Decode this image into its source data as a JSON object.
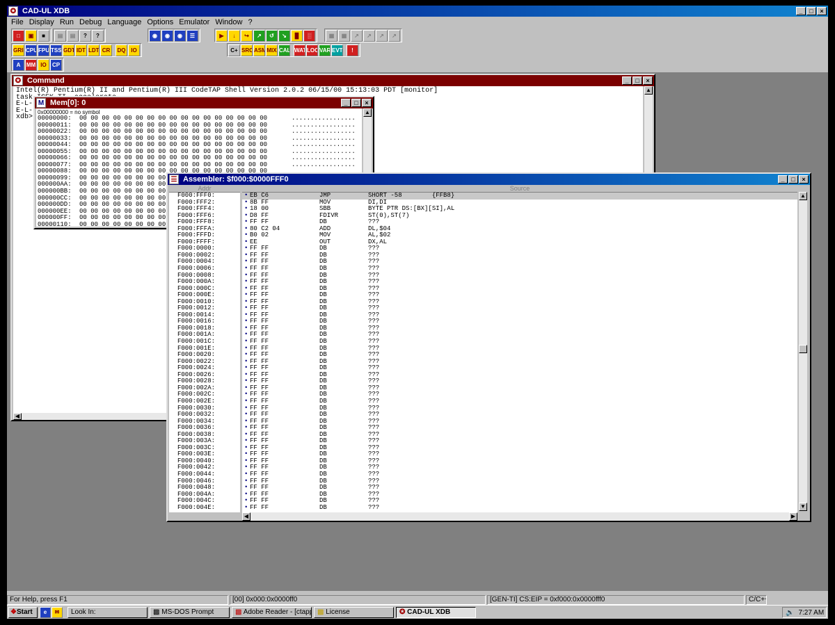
{
  "app": {
    "title": "CAD-UL XDB",
    "window_controls": [
      "_",
      "□",
      "×"
    ]
  },
  "menu": [
    "File",
    "Display",
    "Run",
    "Debug",
    "Language",
    "Options",
    "Emulator",
    "Window",
    "?"
  ],
  "toolbar": {
    "row1": [
      [
        "new-icon",
        "open-icon",
        "save-icon"
      ],
      [
        "copy-icon",
        "print-icon",
        "help-icon",
        "context-help-icon"
      ],
      [
        "search-icon",
        "search-next-icon",
        "search-prev-icon",
        "list-icon"
      ],
      [
        "go-icon",
        "step-icon",
        "stepover-icon",
        "break-icon",
        "reset-icon",
        "watch-icon",
        "stack-icon",
        "trace-icon",
        "regs-icon"
      ],
      [
        "disabled-a-icon",
        "disabled-b-icon",
        "disabled-c-icon",
        "disabled-d-icon",
        "disabled-e-icon",
        "disabled-f-icon"
      ]
    ],
    "row1_labels": [
      [
        "",
        "",
        ""
      ],
      [
        "",
        "",
        "?",
        "?"
      ],
      [
        "",
        "",
        "",
        ""
      ],
      [
        "",
        "",
        "",
        "",
        "",
        "",
        "",
        "",
        ""
      ],
      [
        "",
        "",
        "",
        "",
        "",
        ""
      ]
    ],
    "row2_left": [
      "GRID",
      "CPU",
      "FPU",
      "TSS",
      "GDT",
      "IDT",
      "LDT",
      "CR",
      "DQ",
      "IO"
    ],
    "row2_right": [
      "C+",
      "SRC",
      "ASM",
      "MIX",
      "CALL",
      "WAT",
      "LOC",
      "VAR",
      "EVT",
      "!"
    ],
    "row3": [
      "A",
      "MM",
      "IO",
      "CP"
    ]
  },
  "command_window": {
    "title": "Command",
    "lines": [
      "Intel(R) Pentium(R) II and Pentium(R) III CodeTAP Shell Version 2.0.2 06/15/00 15:13:03 PDT [monitor]",
      "task ICEK_TI, accelerate",
      "E-L-",
      "E-L-",
      "xdb>"
    ]
  },
  "mem_window": {
    "title": "Mem[0]: 0",
    "header": "0x00000000 = no symbol",
    "rows": [
      {
        "addr": "00000000:",
        "bytes": "00 00 00 00 00 00 00 00 00 00 00 00 00 00 00 00 00",
        "ascii": "................."
      },
      {
        "addr": "00000011:",
        "bytes": "00 00 00 00 00 00 00 00 00 00 00 00 00 00 00 00 00",
        "ascii": "................."
      },
      {
        "addr": "00000022:",
        "bytes": "00 00 00 00 00 00 00 00 00 00 00 00 00 00 00 00 00",
        "ascii": "................."
      },
      {
        "addr": "00000033:",
        "bytes": "00 00 00 00 00 00 00 00 00 00 00 00 00 00 00 00 00",
        "ascii": "................."
      },
      {
        "addr": "00000044:",
        "bytes": "00 00 00 00 00 00 00 00 00 00 00 00 00 00 00 00 00",
        "ascii": "................."
      },
      {
        "addr": "00000055:",
        "bytes": "00 00 00 00 00 00 00 00 00 00 00 00 00 00 00 00 00",
        "ascii": "................."
      },
      {
        "addr": "00000066:",
        "bytes": "00 00 00 00 00 00 00 00 00 00 00 00 00 00 00 00 00",
        "ascii": "................."
      },
      {
        "addr": "00000077:",
        "bytes": "00 00 00 00 00 00 00 00 00 00 00 00 00 00 00 00 00",
        "ascii": "................."
      },
      {
        "addr": "00000088:",
        "bytes": "00 00 00 00 00 00 00 00 00 00 00 00 00 00 00 00 00",
        "ascii": ""
      },
      {
        "addr": "00000099:",
        "bytes": "00 00 00 00 00 00 00 00 00 00 00 00",
        "ascii": ""
      },
      {
        "addr": "000000AA:",
        "bytes": "00 00 00 00 00 00 00 00 00 00 00 00",
        "ascii": ""
      },
      {
        "addr": "000000BB:",
        "bytes": "00 00 00 00 00 00 00 00 00 00 00 00",
        "ascii": ""
      },
      {
        "addr": "000000CC:",
        "bytes": "00 00 00 00 00 00 00 00 00 00 00 00",
        "ascii": ""
      },
      {
        "addr": "000000DD:",
        "bytes": "00 00 00 00 00 00 00 00 00 00 00 00",
        "ascii": ""
      },
      {
        "addr": "000000EE:",
        "bytes": "00 00 00 00 00 00 00 00 00 00 00 00",
        "ascii": ""
      },
      {
        "addr": "000000FF:",
        "bytes": "00 00 00 00 00 00 00 00 00 00 00 00",
        "ascii": ""
      },
      {
        "addr": "00000110:",
        "bytes": "00 00 00 00 00 00 00 00 00 00 00 00",
        "ascii": ""
      }
    ]
  },
  "asm_window": {
    "title": "Assembler:  $f000:$0000FFF0",
    "col_addr": "Addr",
    "col_source": "Source",
    "rows": [
      {
        "addr": "F000:FFF0:",
        "bytes": "EB C6",
        "mn": "JMP",
        "op": "SHORT -58        {FFB8}"
      },
      {
        "addr": "F000:FFF2:",
        "bytes": "8B FF",
        "mn": "MOV",
        "op": "DI,DI"
      },
      {
        "addr": "F000:FFF4:",
        "bytes": "18 00",
        "mn": "SBB",
        "op": "BYTE PTR DS:[BX][SI],AL"
      },
      {
        "addr": "F000:FFF6:",
        "bytes": "D8 FF",
        "mn": "FDIVR",
        "op": "ST(0),ST(7)"
      },
      {
        "addr": "F000:FFF8:",
        "bytes": "FF FF",
        "mn": "DB",
        "op": "???"
      },
      {
        "addr": "F000:FFFA:",
        "bytes": "80 C2 04",
        "mn": "ADD",
        "op": "DL,$04"
      },
      {
        "addr": "F000:FFFD:",
        "bytes": "B0 02",
        "mn": "MOV",
        "op": "AL,$02"
      },
      {
        "addr": "F000:FFFF:",
        "bytes": "EE",
        "mn": "OUT",
        "op": "DX,AL"
      },
      {
        "addr": "F000:0000:",
        "bytes": "FF FF",
        "mn": "DB",
        "op": "???"
      },
      {
        "addr": "F000:0002:",
        "bytes": "FF FF",
        "mn": "DB",
        "op": "???"
      },
      {
        "addr": "F000:0004:",
        "bytes": "FF FF",
        "mn": "DB",
        "op": "???"
      },
      {
        "addr": "F000:0006:",
        "bytes": "FF FF",
        "mn": "DB",
        "op": "???"
      },
      {
        "addr": "F000:0008:",
        "bytes": "FF FF",
        "mn": "DB",
        "op": "???"
      },
      {
        "addr": "F000:000A:",
        "bytes": "FF FF",
        "mn": "DB",
        "op": "???"
      },
      {
        "addr": "F000:000C:",
        "bytes": "FF FF",
        "mn": "DB",
        "op": "???"
      },
      {
        "addr": "F000:000E:",
        "bytes": "FF FF",
        "mn": "DB",
        "op": "???"
      },
      {
        "addr": "F000:0010:",
        "bytes": "FF FF",
        "mn": "DB",
        "op": "???"
      },
      {
        "addr": "F000:0012:",
        "bytes": "FF FF",
        "mn": "DB",
        "op": "???"
      },
      {
        "addr": "F000:0014:",
        "bytes": "FF FF",
        "mn": "DB",
        "op": "???"
      },
      {
        "addr": "F000:0016:",
        "bytes": "FF FF",
        "mn": "DB",
        "op": "???"
      },
      {
        "addr": "F000:0018:",
        "bytes": "FF FF",
        "mn": "DB",
        "op": "???"
      },
      {
        "addr": "F000:001A:",
        "bytes": "FF FF",
        "mn": "DB",
        "op": "???"
      },
      {
        "addr": "F000:001C:",
        "bytes": "FF FF",
        "mn": "DB",
        "op": "???"
      },
      {
        "addr": "F000:001E:",
        "bytes": "FF FF",
        "mn": "DB",
        "op": "???"
      },
      {
        "addr": "F000:0020:",
        "bytes": "FF FF",
        "mn": "DB",
        "op": "???"
      },
      {
        "addr": "F000:0022:",
        "bytes": "FF FF",
        "mn": "DB",
        "op": "???"
      },
      {
        "addr": "F000:0024:",
        "bytes": "FF FF",
        "mn": "DB",
        "op": "???"
      },
      {
        "addr": "F000:0026:",
        "bytes": "FF FF",
        "mn": "DB",
        "op": "???"
      },
      {
        "addr": "F000:0028:",
        "bytes": "FF FF",
        "mn": "DB",
        "op": "???"
      },
      {
        "addr": "F000:002A:",
        "bytes": "FF FF",
        "mn": "DB",
        "op": "???"
      },
      {
        "addr": "F000:002C:",
        "bytes": "FF FF",
        "mn": "DB",
        "op": "???"
      },
      {
        "addr": "F000:002E:",
        "bytes": "FF FF",
        "mn": "DB",
        "op": "???"
      },
      {
        "addr": "F000:0030:",
        "bytes": "FF FF",
        "mn": "DB",
        "op": "???"
      },
      {
        "addr": "F000:0032:",
        "bytes": "FF FF",
        "mn": "DB",
        "op": "???"
      },
      {
        "addr": "F000:0034:",
        "bytes": "FF FF",
        "mn": "DB",
        "op": "???"
      },
      {
        "addr": "F000:0036:",
        "bytes": "FF FF",
        "mn": "DB",
        "op": "???"
      },
      {
        "addr": "F000:0038:",
        "bytes": "FF FF",
        "mn": "DB",
        "op": "???"
      },
      {
        "addr": "F000:003A:",
        "bytes": "FF FF",
        "mn": "DB",
        "op": "???"
      },
      {
        "addr": "F000:003C:",
        "bytes": "FF FF",
        "mn": "DB",
        "op": "???"
      },
      {
        "addr": "F000:003E:",
        "bytes": "FF FF",
        "mn": "DB",
        "op": "???"
      },
      {
        "addr": "F000:0040:",
        "bytes": "FF FF",
        "mn": "DB",
        "op": "???"
      },
      {
        "addr": "F000:0042:",
        "bytes": "FF FF",
        "mn": "DB",
        "op": "???"
      },
      {
        "addr": "F000:0044:",
        "bytes": "FF FF",
        "mn": "DB",
        "op": "???"
      },
      {
        "addr": "F000:0046:",
        "bytes": "FF FF",
        "mn": "DB",
        "op": "???"
      },
      {
        "addr": "F000:0048:",
        "bytes": "FF FF",
        "mn": "DB",
        "op": "???"
      },
      {
        "addr": "F000:004A:",
        "bytes": "FF FF",
        "mn": "DB",
        "op": "???"
      },
      {
        "addr": "F000:004C:",
        "bytes": "FF FF",
        "mn": "DB",
        "op": "???"
      },
      {
        "addr": "F000:004E:",
        "bytes": "FF FF",
        "mn": "DB",
        "op": "???"
      }
    ]
  },
  "status": {
    "help": "For Help, press F1",
    "mem_addr": "[00] 0x000:0x0000ff0",
    "target": "[GEN-TI] CS:EIP = 0xf000:0x0000fff0",
    "lang": "C/C++"
  },
  "taskbar": {
    "start": "Start",
    "tasks": [
      {
        "label": "Look In:",
        "active": false
      },
      {
        "label": "MS-DOS Prompt",
        "active": false
      },
      {
        "label": "Adobe Reader - [ctapp.pdf]",
        "active": false
      },
      {
        "label": "License",
        "active": false
      },
      {
        "label": "CAD-UL XDB",
        "active": true
      }
    ],
    "clock": "7:27 AM"
  },
  "colors": {
    "active_title": "#000080",
    "inactive_title": "#7b0000",
    "desktop": "#808080",
    "face": "#c0c0c0"
  }
}
